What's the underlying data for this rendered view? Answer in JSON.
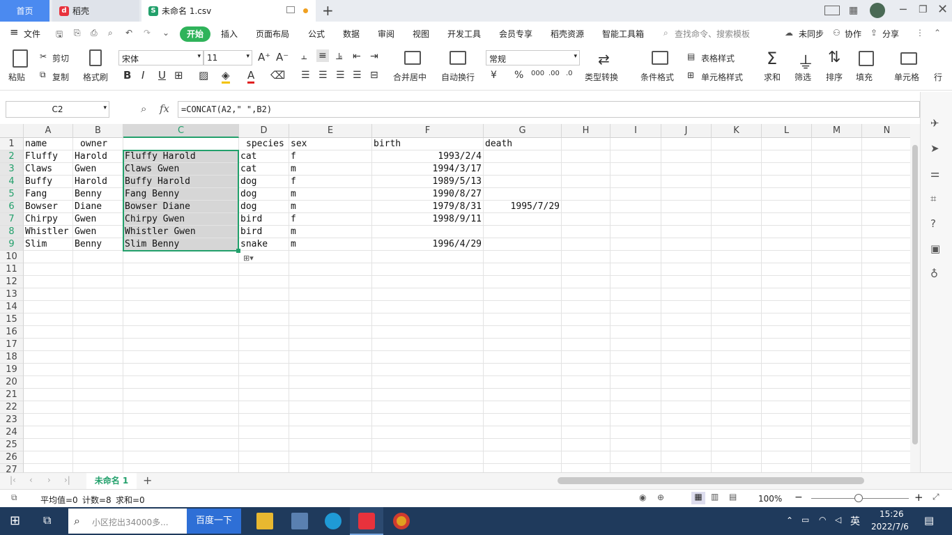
{
  "tabs": {
    "home": "首页",
    "daoke": "稻壳",
    "file": "未命名 1.csv"
  },
  "menu": [
    "文件",
    "开始",
    "插入",
    "页面布局",
    "公式",
    "数据",
    "审阅",
    "视图",
    "开发工具",
    "会员专享",
    "稻壳资源",
    "智能工具箱"
  ],
  "search_placeholder": "查找命令、搜索模板",
  "menu_right": {
    "sync": "未同步",
    "collab": "协作",
    "share": "分享"
  },
  "ribbon": {
    "paste": "粘贴",
    "cut": "剪切",
    "copy": "复制",
    "format_painter": "格式刷",
    "font_name": "宋体",
    "font_size": "11",
    "merge_center": "合并居中",
    "wrap_text": "自动换行",
    "number_format": "常规",
    "type_convert": "类型转换",
    "cond_format": "条件格式",
    "table_style": "表格样式",
    "cell_style": "单元格样式",
    "sum": "求和",
    "filter": "筛选",
    "sort": "排序",
    "fill": "填充",
    "cell": "单元格",
    "row_col": "行"
  },
  "formula_bar": {
    "name_box": "C2",
    "fx": "fx",
    "formula": "=CONCAT(A2,\" \",B2)"
  },
  "columns": [
    "A",
    "B",
    "C",
    "D",
    "E",
    "F",
    "G",
    "H",
    "I",
    "J",
    "K",
    "L",
    "M",
    "N"
  ],
  "rows": [
    1,
    2,
    3,
    4,
    5,
    6,
    7,
    8,
    9,
    10,
    11,
    12,
    13,
    14,
    15,
    16,
    17,
    18,
    19,
    20,
    21,
    22,
    23,
    24,
    25,
    26,
    27
  ],
  "header_row": [
    "name",
    "owner",
    "",
    "species",
    "sex",
    "birth",
    "death"
  ],
  "data_rows": [
    {
      "name": "Fluffy",
      "owner": "Harold",
      "concat": "Fluffy Harold",
      "species": "cat",
      "sex": "f",
      "birth": "1993/2/4",
      "death": ""
    },
    {
      "name": "Claws",
      "owner": "Gwen",
      "concat": "Claws Gwen",
      "species": "cat",
      "sex": "m",
      "birth": "1994/3/17",
      "death": ""
    },
    {
      "name": "Buffy",
      "owner": "Harold",
      "concat": "Buffy Harold",
      "species": "dog",
      "sex": "f",
      "birth": "1989/5/13",
      "death": ""
    },
    {
      "name": "Fang",
      "owner": "Benny",
      "concat": "Fang Benny",
      "species": "dog",
      "sex": "m",
      "birth": "1990/8/27",
      "death": ""
    },
    {
      "name": "Bowser",
      "owner": "Diane",
      "concat": "Bowser Diane",
      "species": "dog",
      "sex": "m",
      "birth": "1979/8/31",
      "death": "1995/7/29"
    },
    {
      "name": "Chirpy",
      "owner": "Gwen",
      "concat": "Chirpy Gwen",
      "species": "bird",
      "sex": "f",
      "birth": "1998/9/11",
      "death": ""
    },
    {
      "name": "Whistler",
      "owner": "Gwen",
      "concat": "Whistler Gwen",
      "species": "bird",
      "sex": "m",
      "birth": "",
      "death": ""
    },
    {
      "name": "Slim",
      "owner": "Benny",
      "concat": "Slim Benny",
      "species": "snake",
      "sex": "m",
      "birth": "1996/4/29",
      "death": ""
    }
  ],
  "sheet_tab": "未命名 1",
  "status": {
    "avg": "平均值=0",
    "count": "计数=8",
    "sum": "求和=0",
    "zoom": "100%"
  },
  "taskbar": {
    "search_placeholder": "小区挖出34000多...",
    "search_button": "百度一下",
    "ime": "英",
    "time": "15:26",
    "date": "2022/7/6"
  },
  "colors": {
    "accent": "#22a06b",
    "home_tab": "#4b8af0",
    "start_btn": "#2fb35a",
    "taskbar": "#1f3a5c"
  }
}
